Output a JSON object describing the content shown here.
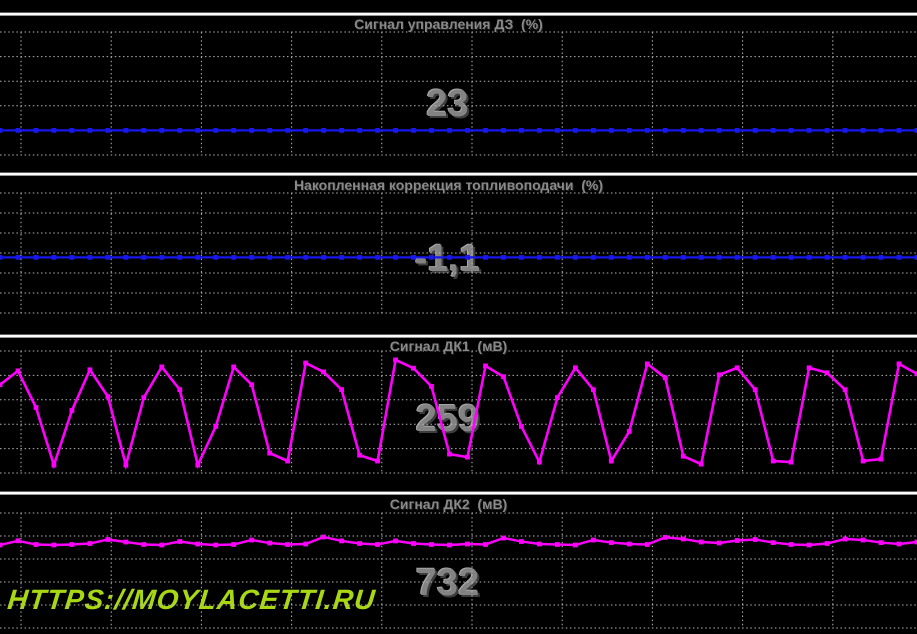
{
  "watermark": {
    "text": "HTTPS://MOYLACETTI.RU",
    "color": "#a8d714"
  },
  "colors": {
    "background": "#000000",
    "grid_dots": "#b4b4b4",
    "separator_bar": "#fdfdfd",
    "title_text": "#898989",
    "value_text": "#838383",
    "blue_series": "#1717ee",
    "magenta_series": "#ff00ff"
  },
  "chart_data": [
    {
      "type": "line",
      "title": "Сигнал управления ДЗ  (%)",
      "unit": "%",
      "current_value": "23",
      "color": "#1717ee",
      "ylim": [
        0,
        115
      ],
      "grid": {
        "h_gridlines": 6,
        "v_gridlines": 10,
        "grid_on": true
      },
      "values": [
        23,
        23,
        23,
        23,
        23,
        23,
        23,
        23,
        23,
        23,
        23,
        23,
        23,
        23,
        23,
        23,
        23,
        23,
        23,
        23,
        23,
        23,
        23,
        23,
        23,
        23,
        23,
        23,
        23,
        23,
        23,
        23,
        23,
        23,
        23,
        23,
        23,
        23,
        23,
        23,
        23,
        23,
        23,
        23,
        23,
        23,
        23,
        23,
        23,
        23,
        23,
        23
      ]
    },
    {
      "type": "line",
      "title": "Накопленная коррекция топливоподачи  (%)",
      "unit": "%",
      "current_value": "-1,1",
      "color": "#1717ee",
      "ylim": [
        -15,
        15
      ],
      "grid": {
        "h_gridlines": 7,
        "v_gridlines": 10,
        "grid_on": true
      },
      "values": [
        -1.1,
        -1.1,
        -1.1,
        -1.1,
        -1.1,
        -1.1,
        -1.1,
        -1.1,
        -1.1,
        -1.1,
        -1.1,
        -1.1,
        -1.1,
        -1.1,
        -1.1,
        -1.1,
        -1.1,
        -1.1,
        -1.1,
        -1.1,
        -1.1,
        -1.1,
        -1.1,
        -1.1,
        -1.1,
        -1.1,
        -1.1,
        -1.1,
        -1.1,
        -1.1,
        -1.1,
        -1.1,
        -1.1,
        -1.1,
        -1.1,
        -1.1,
        -1.1,
        -1.1,
        -1.1,
        -1.1,
        -1.1,
        -1.1,
        -1.1,
        -1.1,
        -1.1,
        -1.1,
        -1.1,
        -1.1,
        -1.1,
        -1.1,
        -1.1,
        -1.1
      ]
    },
    {
      "type": "line",
      "title": "Сигнал ДК1  (мВ)",
      "unit": "мВ",
      "current_value": "259",
      "color": "#ff00ff",
      "ylim": [
        0,
        1000
      ],
      "grid": {
        "h_gridlines": 6,
        "v_gridlines": 10,
        "grid_on": true
      },
      "values": [
        724,
        837,
        537,
        65,
        512,
        846,
        626,
        65,
        618,
        870,
        683,
        65,
        382,
        870,
        724,
        163,
        98,
        902,
        829,
        683,
        146,
        98,
        927,
        859,
        710,
        155,
        130,
        878,
        789,
        382,
        89,
        618,
        862,
        683,
        98,
        341,
        894,
        780,
        138,
        73,
        805,
        862,
        683,
        98,
        89,
        862,
        821,
        683,
        98,
        114,
        894,
        813
      ]
    },
    {
      "type": "line",
      "title": "Сигнал ДК2  (мВ)",
      "unit": "мВ",
      "current_value": "732",
      "color": "#ff00ff",
      "ylim": [
        0,
        1000
      ],
      "grid": {
        "h_gridlines": 6,
        "v_gridlines": 10,
        "grid_on": true
      },
      "values": [
        722,
        758,
        726,
        722,
        726,
        735,
        770,
        748,
        726,
        722,
        752,
        730,
        722,
        726,
        765,
        739,
        726,
        730,
        791,
        757,
        735,
        726,
        757,
        735,
        726,
        722,
        730,
        726,
        783,
        752,
        730,
        726,
        722,
        765,
        743,
        730,
        726,
        788,
        774,
        748,
        739,
        761,
        770,
        743,
        726,
        722,
        735,
        774,
        765,
        743,
        730,
        748
      ]
    }
  ]
}
